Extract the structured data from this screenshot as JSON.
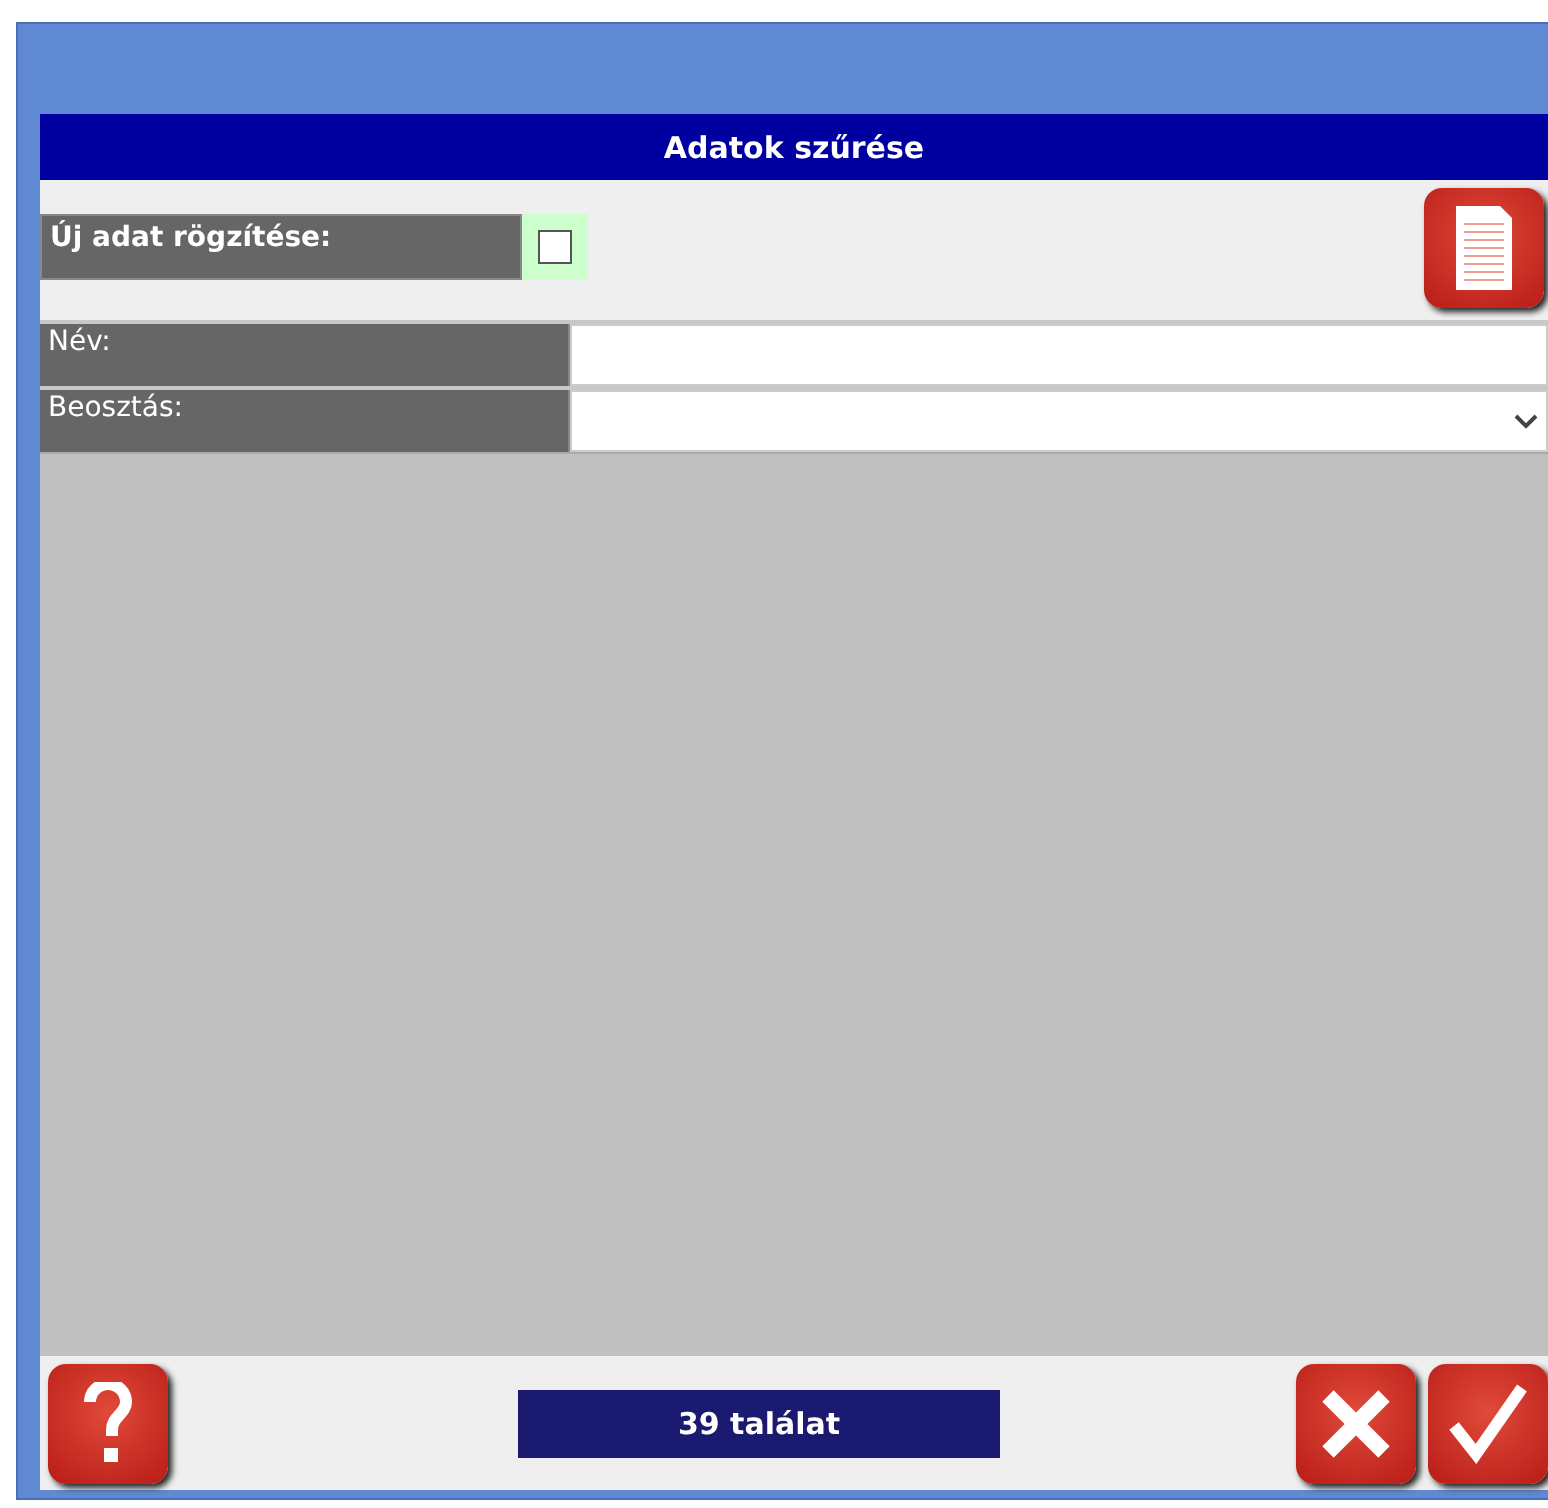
{
  "dialog": {
    "title": "Adatok szűrése"
  },
  "new_record": {
    "label": "Új adat rögzítése:",
    "checked": false
  },
  "fields": [
    {
      "kind": "text",
      "label": "Név:"
    },
    {
      "kind": "select",
      "label": "Beosztás:"
    }
  ],
  "status": {
    "count": "39 találat"
  }
}
